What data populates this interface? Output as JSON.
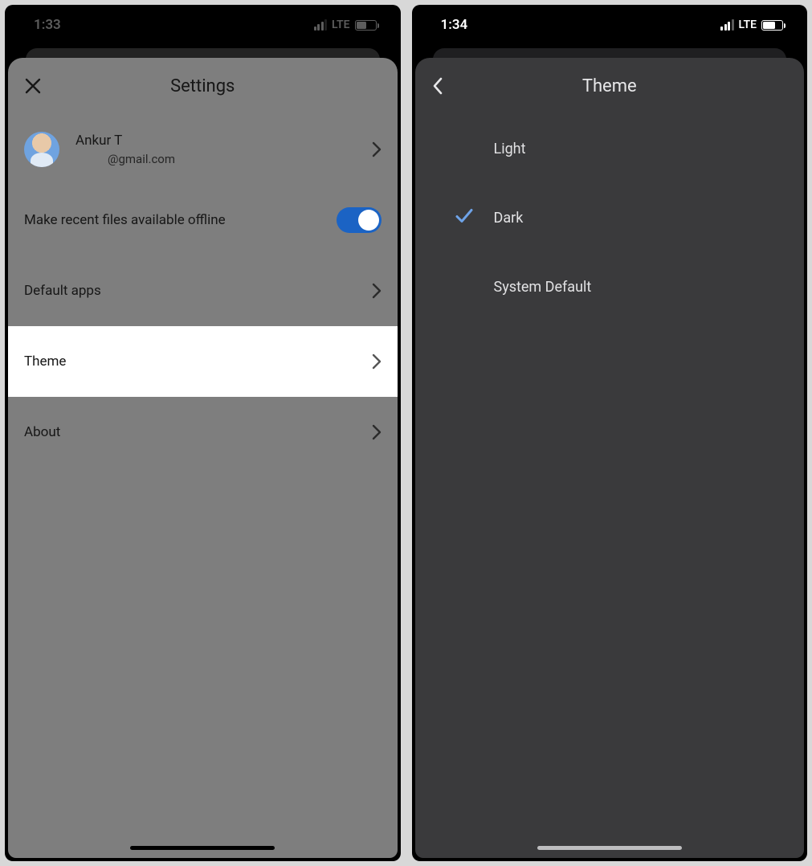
{
  "left": {
    "status": {
      "time": "1:33",
      "net": "LTE"
    },
    "header": {
      "title": "Settings"
    },
    "account": {
      "name": "Ankur T",
      "email_suffix": "@gmail.com"
    },
    "rows": {
      "offline": "Make recent files available offline",
      "default_apps": "Default apps",
      "theme": "Theme",
      "about": "About"
    },
    "toggle_on": true
  },
  "right": {
    "status": {
      "time": "1:34",
      "net": "LTE"
    },
    "header": {
      "title": "Theme"
    },
    "options": [
      {
        "label": "Light",
        "selected": false
      },
      {
        "label": "Dark",
        "selected": true
      },
      {
        "label": "System Default",
        "selected": false
      }
    ]
  },
  "icons": {
    "close": "close-icon",
    "back": "back-chevron-icon",
    "chevron": "chevron-right-icon",
    "check": "check-icon",
    "signal": "cell-signal-icon",
    "battery": "battery-icon"
  }
}
